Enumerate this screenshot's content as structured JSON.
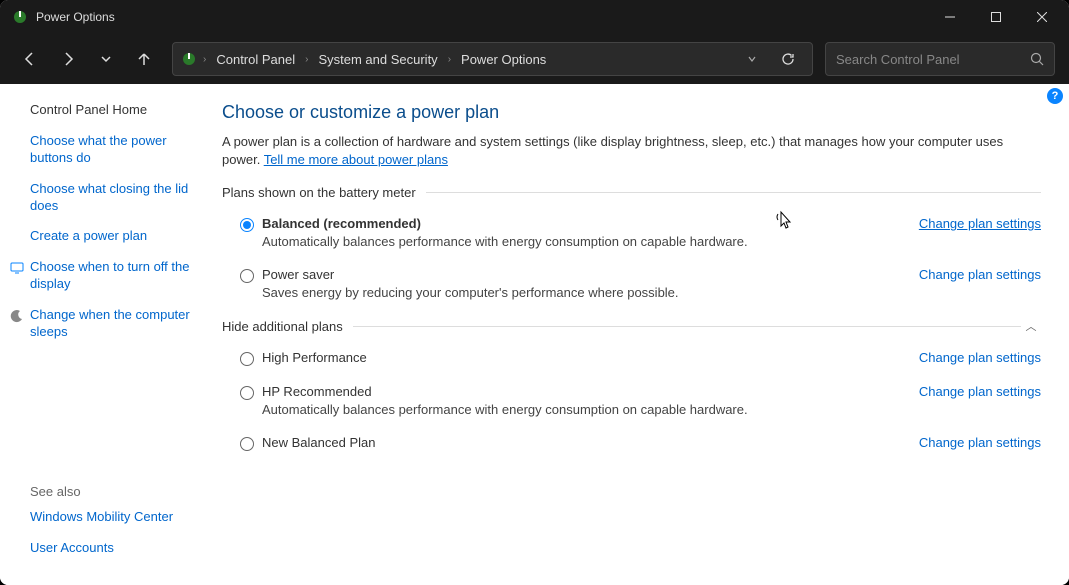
{
  "window": {
    "title": "Power Options"
  },
  "breadcrumb": {
    "root": "Control Panel",
    "cat": "System and Security",
    "page": "Power Options"
  },
  "search": {
    "placeholder": "Search Control Panel"
  },
  "sidebar": {
    "home": "Control Panel Home",
    "links": [
      "Choose what the power buttons do",
      "Choose what closing the lid does",
      "Create a power plan"
    ],
    "iconlinks": [
      "Choose when to turn off the display",
      "Change when the computer sleeps"
    ],
    "see_also_hdr": "See also",
    "see_also": [
      "Windows Mobility Center",
      "User Accounts"
    ]
  },
  "main": {
    "heading": "Choose or customize a power plan",
    "intro_a": "A power plan is a collection of hardware and system settings (like display brightness, sleep, etc.) that manages how your computer uses power. ",
    "intro_link": "Tell me more about power plans",
    "section1": "Plans shown on the battery meter",
    "section2": "Hide additional plans",
    "change_link": "Change plan settings",
    "plans_a": [
      {
        "name": "Balanced (recommended)",
        "desc": "Automatically balances performance with energy consumption on capable hardware.",
        "selected": true
      },
      {
        "name": "Power saver",
        "desc": "Saves energy by reducing your computer's performance where possible.",
        "selected": false
      }
    ],
    "plans_b": [
      {
        "name": "High Performance",
        "desc": "",
        "selected": false
      },
      {
        "name": "HP Recommended",
        "desc": "Automatically balances performance with energy consumption on capable hardware.",
        "selected": false
      },
      {
        "name": "New Balanced Plan",
        "desc": "",
        "selected": false
      }
    ]
  }
}
